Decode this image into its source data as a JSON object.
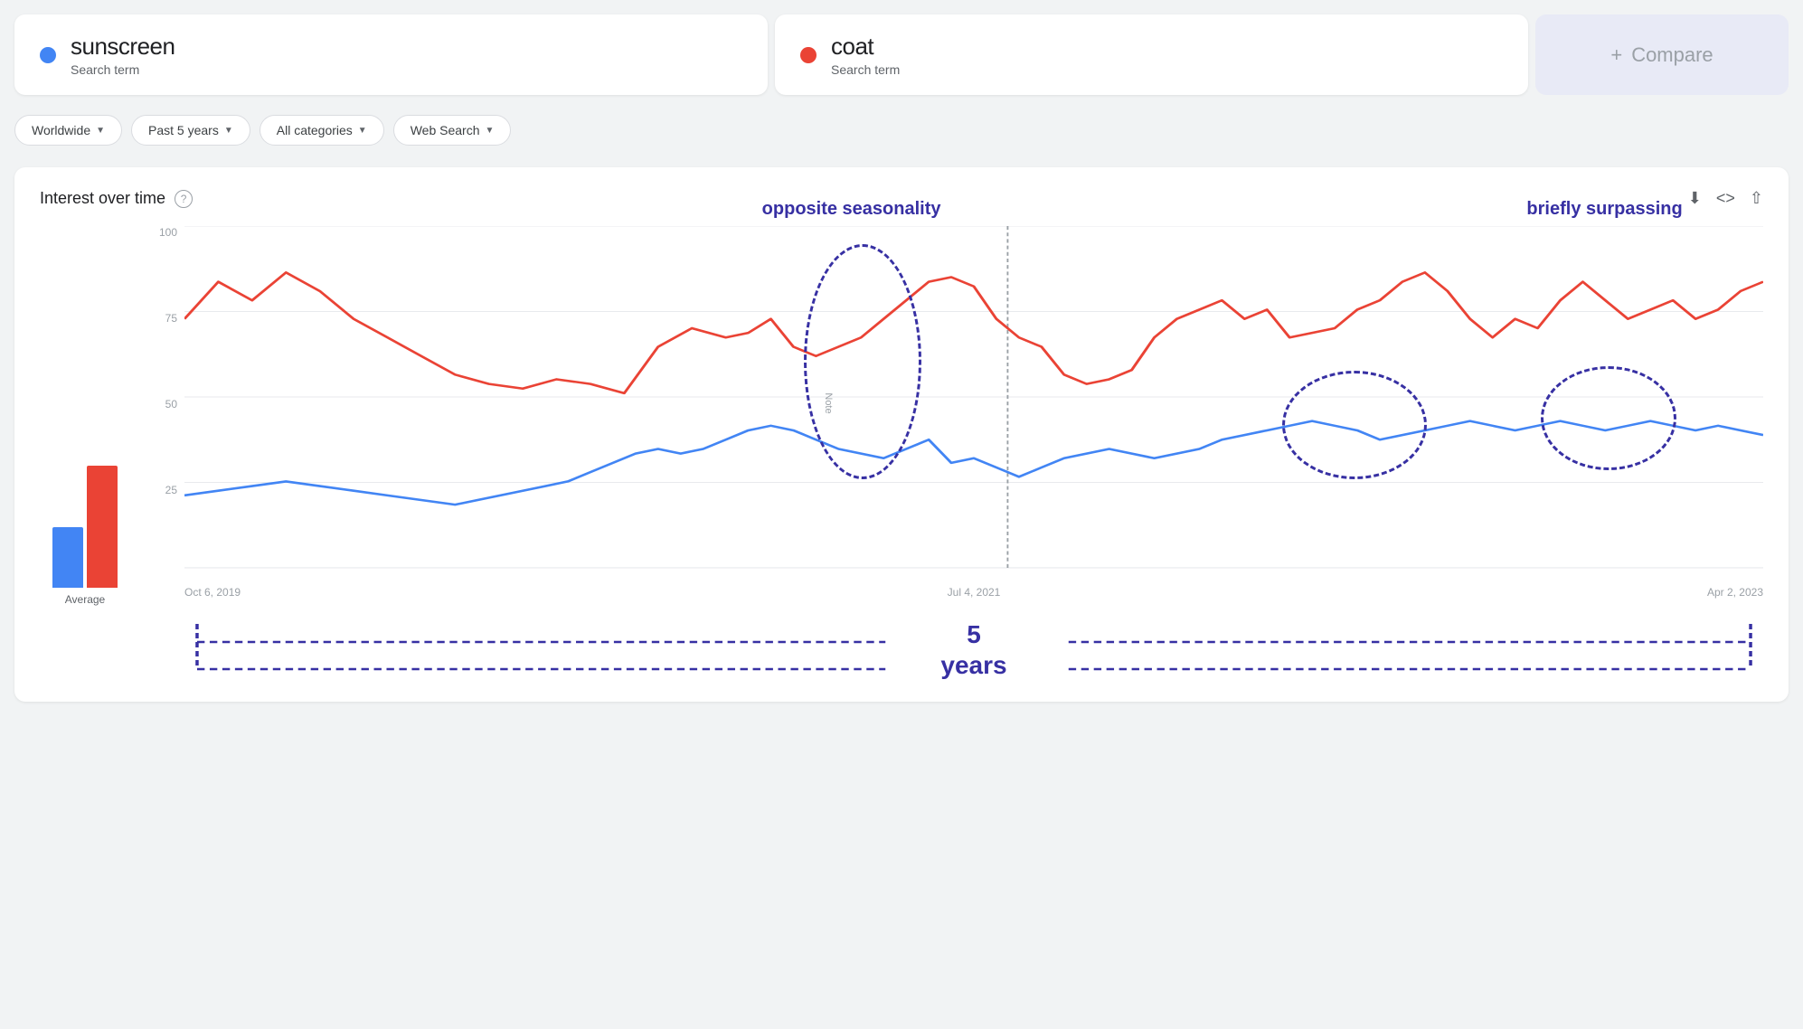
{
  "terms": [
    {
      "name": "sunscreen",
      "type": "Search term",
      "color": "#4285f4",
      "dot_color": "#4285f4"
    },
    {
      "name": "coat",
      "type": "Search term",
      "color": "#ea4335",
      "dot_color": "#ea4335"
    }
  ],
  "compare": {
    "icon": "+",
    "label": "Compare"
  },
  "filters": [
    {
      "id": "location",
      "label": "Worldwide"
    },
    {
      "id": "timerange",
      "label": "Past 5 years"
    },
    {
      "id": "category",
      "label": "All categories"
    },
    {
      "id": "searchtype",
      "label": "Web Search"
    }
  ],
  "chart": {
    "title": "Interest over time",
    "help_label": "?",
    "download_icon": "⬇",
    "embed_icon": "<>",
    "share_icon": "⇧",
    "y_labels": [
      "100",
      "75",
      "50",
      "25"
    ],
    "x_labels": [
      "Oct 6, 2019",
      "Jul 4, 2021",
      "Apr 2, 2023"
    ],
    "note_label": "Note",
    "avg_label": "Average",
    "annotations": {
      "opposite_seasonality": "opposite seasonality",
      "briefly_surpassing": "briefly surpassing",
      "five_years": "5\nyears"
    },
    "bars": {
      "sunscreen_height_pct": 30,
      "coat_height_pct": 60,
      "sunscreen_color": "#4285f4",
      "coat_color": "#ea4335"
    }
  }
}
